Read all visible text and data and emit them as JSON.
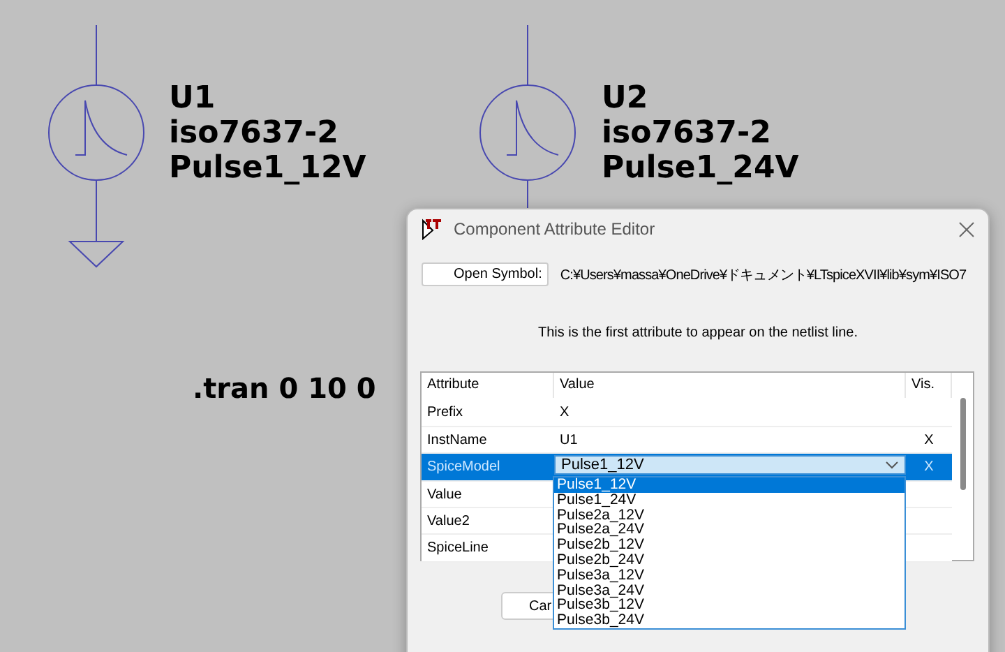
{
  "schematic": {
    "symbols": [
      {
        "name": "U1",
        "model": "iso7637-2",
        "value": "Pulse1_12V"
      },
      {
        "name": "U2",
        "model": "iso7637-2",
        "value": "Pulse1_24V"
      }
    ],
    "directive": ".tran 0 10 0"
  },
  "dialog": {
    "title": "Component Attribute Editor",
    "open_symbol_button": "Open Symbol:",
    "symbol_path": "C:¥Users¥massa¥OneDrive¥ドキュメント¥LTspiceXVII¥lib¥sym¥ISO7",
    "description": "This is the first attribute to appear on the netlist line.",
    "table": {
      "columns": [
        "Attribute",
        "Value",
        "Vis."
      ],
      "rows": [
        {
          "attribute": "Prefix",
          "value": "X",
          "vis": "",
          "selected": false
        },
        {
          "attribute": "InstName",
          "value": "U1",
          "vis": "X",
          "selected": false
        },
        {
          "attribute": "SpiceModel",
          "value": "Pulse1_12V",
          "vis": "X",
          "selected": true
        },
        {
          "attribute": "Value",
          "selected": false
        },
        {
          "attribute": "Value2",
          "selected": false
        },
        {
          "attribute": "SpiceLine",
          "selected": false
        }
      ]
    },
    "dropdown_options": [
      {
        "label": "Pulse1_12V",
        "selected": true
      },
      {
        "label": "Pulse1_24V",
        "selected": false
      },
      {
        "label": "Pulse2a_12V",
        "selected": false
      },
      {
        "label": "Pulse2a_24V",
        "selected": false
      },
      {
        "label": "Pulse2b_12V",
        "selected": false
      },
      {
        "label": "Pulse2b_24V",
        "selected": false
      },
      {
        "label": "Pulse3a_12V",
        "selected": false
      },
      {
        "label": "Pulse3a_24V",
        "selected": false
      },
      {
        "label": "Pulse3b_12V",
        "selected": false
      },
      {
        "label": "Pulse3b_24V",
        "selected": false
      }
    ],
    "buttons": [
      "Car"
    ]
  }
}
